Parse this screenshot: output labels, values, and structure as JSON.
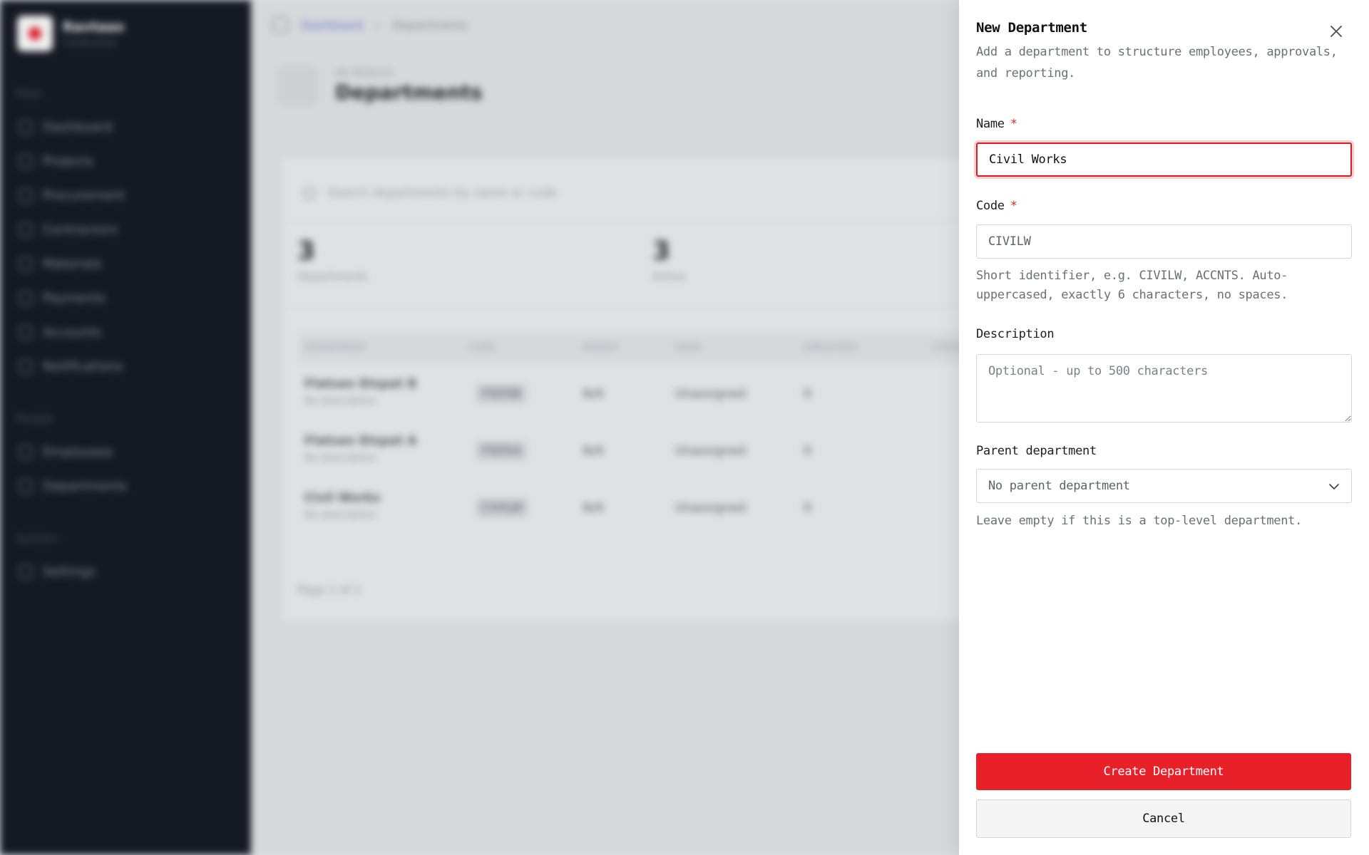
{
  "app": {
    "brand_name": "Ravtaax",
    "brand_sub": "Construction",
    "nav_sections": {
      "main": "Main",
      "people": "People",
      "system": "System"
    },
    "nav_items": {
      "dashboard": "Dashboard",
      "projects": "Projects",
      "procurement": "Procurement",
      "contractors": "Contractors",
      "materials": "Materials",
      "payments": "Payments",
      "accounts": "Accounts",
      "notifications": "Notifications",
      "employees": "Employees",
      "departments": "Departments",
      "settings": "Settings"
    }
  },
  "background": {
    "breadcrumb": {
      "root": "Dashboard",
      "separator": "/",
      "current": "Departments"
    },
    "page_eyebrow": "HR MODULE",
    "page_title": "Departments",
    "search_placeholder": "Search departments by name or code",
    "stats": [
      {
        "value": "3",
        "label": "Departments"
      },
      {
        "value": "3",
        "label": "Active"
      }
    ],
    "table_headers": [
      "DEPARTMENT",
      "CODE",
      "PARENT",
      "HEAD",
      "EMPLOYEES",
      "STATUS"
    ],
    "rows": [
      {
        "name": "Flatsan Dispat B",
        "desc": "No description",
        "code": "FSDSB",
        "parent": "N/A",
        "head": "Unassigned",
        "employees": "0"
      },
      {
        "name": "Flatsan Dispat A",
        "desc": "No description",
        "code": "FSDSA",
        "parent": "N/A",
        "head": "Unassigned",
        "employees": "0"
      },
      {
        "name": "Civil Works",
        "desc": "No description",
        "code": "CIVILW",
        "parent": "N/A",
        "head": "Unassigned",
        "employees": "0"
      }
    ],
    "pager": "Page 1 of 1"
  },
  "drawer": {
    "title": "New Department",
    "description": "Add a department to structure employees, approvals, and reporting.",
    "name_label": "Name",
    "required_mark": "*",
    "name_value": "Civil Works",
    "code_label": "Code",
    "code_value": "CIVILW",
    "code_help": "Short identifier, e.g. CIVILW, ACCNTS. Auto-uppercased, exactly 6 characters, no spaces.",
    "description_label": "Description",
    "description_placeholder": "Optional - up to 500 characters",
    "parent_label": "Parent department",
    "parent_value": "No parent department",
    "parent_help": "Leave empty if this is a top-level department.",
    "create_label": "Create Department",
    "cancel_label": "Cancel"
  },
  "colors": {
    "accent": "#e8202a",
    "focus_ring": "#d81e28",
    "sidebar": "#151a24"
  }
}
